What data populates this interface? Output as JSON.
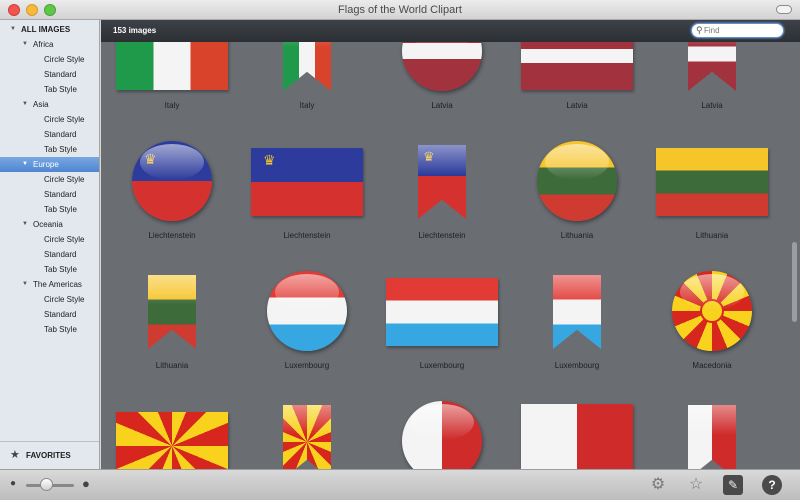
{
  "window": {
    "title": "Flags of the World Clipart"
  },
  "sidebar": {
    "root": "ALL IMAGES",
    "groups": [
      {
        "label": "Africa",
        "items": [
          "Circle Style",
          "Standard",
          "Tab Style"
        ]
      },
      {
        "label": "Asia",
        "items": [
          "Circle Style",
          "Standard",
          "Tab Style"
        ]
      },
      {
        "label": "Europe",
        "items": [
          "Circle Style",
          "Standard",
          "Tab Style"
        ],
        "selected": true
      },
      {
        "label": "Oceania",
        "items": [
          "Circle Style",
          "Standard",
          "Tab Style"
        ]
      },
      {
        "label": "The Americas",
        "items": [
          "Circle Style",
          "Standard",
          "Tab Style"
        ]
      }
    ],
    "favorites": "FAVORITES"
  },
  "toolbar": {
    "count": "153 images",
    "search_placeholder": "Find"
  },
  "colors": {
    "accent": "#4f86d0",
    "content_bg": "#6a6e73"
  },
  "flags": {
    "row1": [
      "Italy",
      "Italy",
      "Latvia",
      "Latvia",
      "Latvia"
    ],
    "row2": [
      "Liechtenstein",
      "Liechtenstein",
      "Liechtenstein",
      "Lithuania",
      "Lithuania"
    ],
    "row3": [
      "Lithuania",
      "Luxembourg",
      "Luxembourg",
      "Luxembourg",
      "Macedonia"
    ]
  },
  "bottom": {
    "icons": [
      "person-small-icon",
      "person-large-icon",
      "gear-icon",
      "star-icon",
      "wrench-icon",
      "help-icon"
    ],
    "help_glyph": "?"
  }
}
